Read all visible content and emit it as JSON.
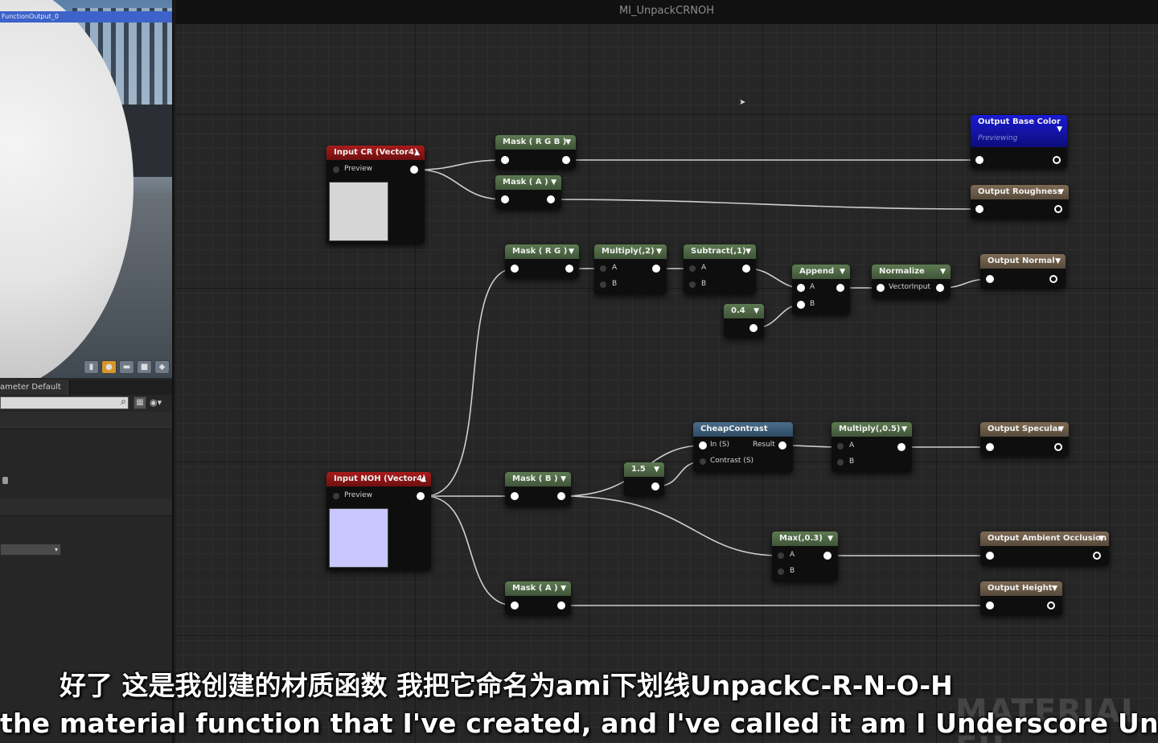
{
  "window": {
    "title": "MI_UnpackCRNOH"
  },
  "viewport": {
    "title": "FunctionOutput_0",
    "toolbar_icons": [
      "cylinder-icon",
      "sphere-icon",
      "plane-icon",
      "cube-icon",
      "mesh-icon"
    ]
  },
  "details": {
    "tab_label": "ameter Default",
    "search_placeholder": ""
  },
  "nodes": {
    "input_cr": {
      "title": "Input CR (Vector4)",
      "preview_label": "Preview",
      "swatch_color": "#d6d6d6"
    },
    "input_noh": {
      "title": "Input NOH (Vector4)",
      "preview_label": "Preview",
      "swatch_color": "#c8c8ff"
    },
    "mask_rgb": {
      "title": "Mask ( R G B )"
    },
    "mask_a_top": {
      "title": "Mask ( A )"
    },
    "mask_rg": {
      "title": "Mask ( R G )"
    },
    "multiply_2": {
      "title": "Multiply(,2)",
      "pin_a": "A",
      "pin_b": "B"
    },
    "subtract_1": {
      "title": "Subtract(,1)",
      "pin_a": "A",
      "pin_b": "B"
    },
    "append": {
      "title": "Append",
      "pin_a": "A",
      "pin_b": "B"
    },
    "const_04": {
      "title": "0.4"
    },
    "normalize": {
      "title": "Normalize",
      "pin_in": "VectorInput"
    },
    "cheap_contrast": {
      "title": "CheapContrast",
      "pin_in": "In (S)",
      "pin_contrast": "Contrast (S)",
      "pin_out": "Result"
    },
    "multiply_05": {
      "title": "Multiply(,0.5)",
      "pin_a": "A",
      "pin_b": "B"
    },
    "const_15": {
      "title": "1.5"
    },
    "mask_b": {
      "title": "Mask ( B )"
    },
    "max_03": {
      "title": "Max(,0.3)",
      "pin_a": "A",
      "pin_b": "B"
    },
    "mask_a_bottom": {
      "title": "Mask ( A )"
    },
    "out_base_color": {
      "title": "Output Base Color",
      "subtitle": "Previewing"
    },
    "out_roughness": {
      "title": "Output Roughness"
    },
    "out_normal": {
      "title": "Output Normal"
    },
    "out_specular": {
      "title": "Output Specular"
    },
    "out_ao": {
      "title": "Output Ambient Occlusion"
    },
    "out_height": {
      "title": "Output Height"
    }
  },
  "subtitles": {
    "zh": "好了 这是我创建的材质函数 我把它命名为ami下划线UnpackC-R-N-O-H",
    "en": "the material function that I've created, and I've called it am I Underscore Unpack C-R-"
  },
  "watermark": "MATERIAL FU",
  "colors": {
    "wire": "#cfcfcf",
    "graph_bg": "#262626",
    "header_green": "#4f6946",
    "header_red": "#8d1515",
    "header_output": "#6a5b49",
    "header_blue": "#1414a8"
  }
}
